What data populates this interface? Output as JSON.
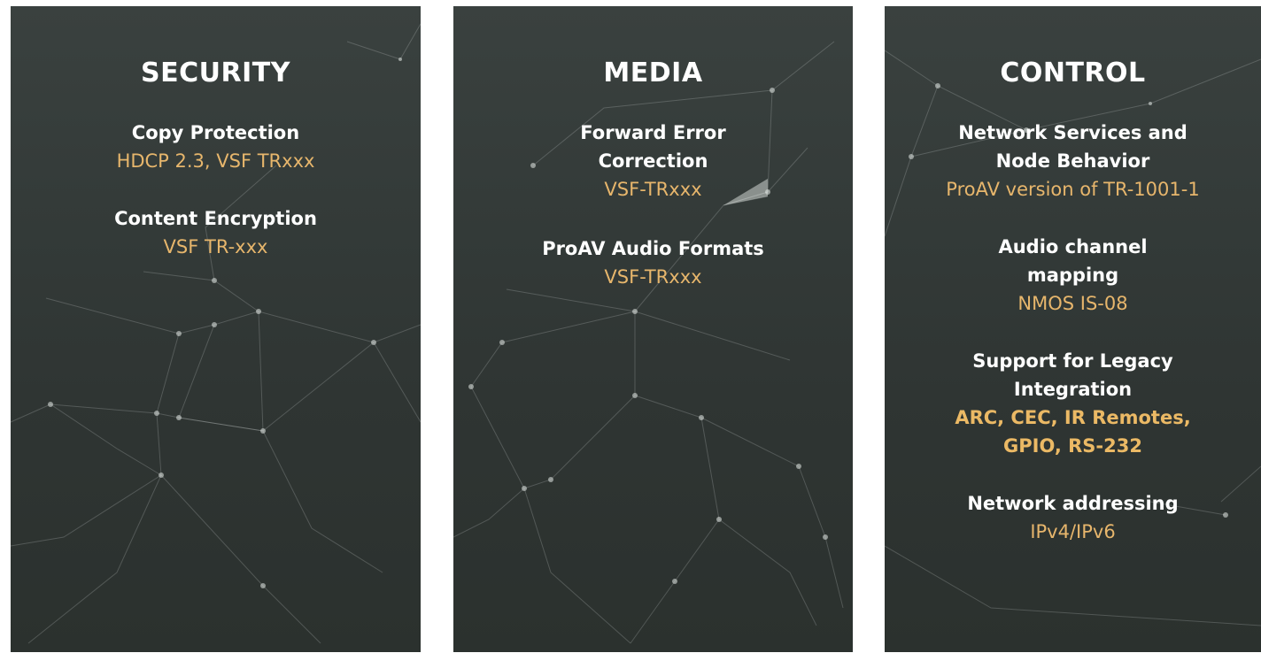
{
  "colors": {
    "panel_background": "#333a38",
    "heading_text": "#ffffff",
    "detail_text": "#e7b66c"
  },
  "background_graphic": "network-mesh",
  "panels": [
    {
      "title": "SECURITY",
      "sections": [
        {
          "heading": "Copy Protection",
          "detail": "HDCP 2.3, VSF TRxxx"
        },
        {
          "heading": "Content Encryption",
          "detail": "VSF TR-xxx"
        }
      ]
    },
    {
      "title": "MEDIA",
      "sections": [
        {
          "heading": "Forward Error Correction",
          "detail": "VSF-TRxxx"
        },
        {
          "heading": "ProAV Audio Formats",
          "detail": "VSF-TRxxx"
        }
      ]
    },
    {
      "title": "CONTROL",
      "sections": [
        {
          "heading": "Network Services and Node Behavior",
          "detail": "ProAV version of TR-1001-1"
        },
        {
          "heading": "Audio channel mapping",
          "detail": "NMOS IS-08"
        },
        {
          "heading": "Support for Legacy Integration",
          "detail": "ARC, CEC, IR Remotes, GPIO, RS-232"
        },
        {
          "heading": "Network addressing",
          "detail": "IPv4/IPv6"
        }
      ]
    }
  ]
}
